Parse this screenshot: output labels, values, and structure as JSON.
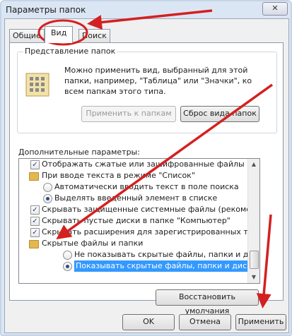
{
  "window": {
    "title": "Параметры папок",
    "close_label": "✕"
  },
  "tabs": [
    {
      "label": "Общие"
    },
    {
      "label": "Вид"
    },
    {
      "label": "Поиск"
    }
  ],
  "folder_view": {
    "legend": "Представление папок",
    "description": "Можно применить вид, выбранный для этой папки, например, \"Таблица\" или \"Значки\", ко всем папкам этого типа.",
    "apply_button": "Применить к папкам",
    "reset_button": "Сброс вида папок"
  },
  "advanced": {
    "label": "Дополнительные параметры:",
    "items": [
      {
        "text": "Отображать сжатые или зашифрованные файлы NTI",
        "type": "checkbox",
        "checked": true
      },
      {
        "text": "При вводе текста в режиме \"Список\"",
        "type": "folder"
      },
      {
        "text": "Автоматически вводить текст в поле поиска",
        "type": "radio",
        "checked": false
      },
      {
        "text": "Выделять введенный элемент в списке",
        "type": "radio",
        "checked": true
      },
      {
        "text": "Скрывать защищенные системные файлы (рекомен,",
        "type": "checkbox",
        "checked": true
      },
      {
        "text": "Скрывать пустые диски в папке \"Компьютер\"",
        "type": "checkbox",
        "checked": true
      },
      {
        "text": "Скрывать расширения для зарегистрированных типо",
        "type": "checkbox",
        "checked": true
      },
      {
        "text": "Скрытые файлы и папки",
        "type": "folder"
      },
      {
        "text": "Не показывать скрытые файлы, папки и диски",
        "type": "radio",
        "checked": false
      },
      {
        "text": "Показывать скрытые файлы, папки и диски",
        "type": "radio",
        "checked": true,
        "selected": true
      }
    ]
  },
  "restore_button": "Восстановить умолчания",
  "footer": {
    "ok": "OK",
    "cancel": "Отмена",
    "apply": "Применить"
  },
  "accent_arrow_color": "#d42020"
}
